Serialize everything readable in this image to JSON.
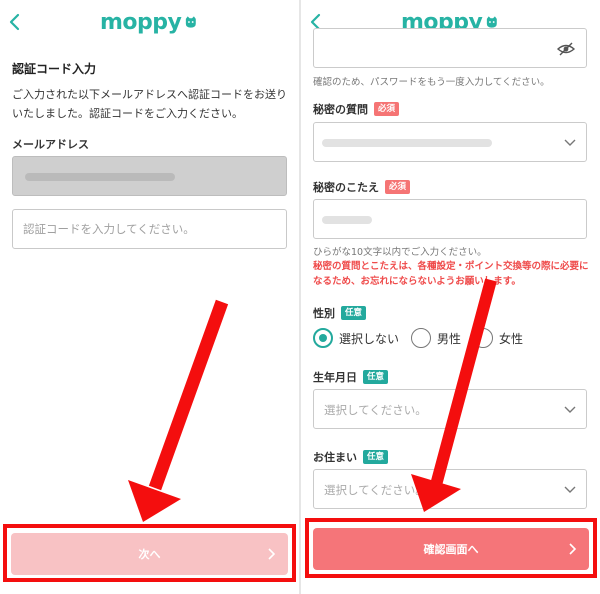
{
  "colors": {
    "brand": "#27b3a4",
    "badge_required": "#f57474",
    "badge_optional": "#23a99d",
    "next_button_disabled": "#f8c2c4",
    "confirm_button": "#f57579",
    "highlight_red": "#f40e0e",
    "warning_text": "#ef4b4b"
  },
  "left": {
    "header": {
      "back_icon": "chevron-left-icon",
      "logo": "moppy"
    },
    "title": "認証コード入力",
    "description": "ご入力された以下メールアドレスへ認証コードをお送りいたしました。認証コードをご入力ください。",
    "email_label": "メールアドレス",
    "code_placeholder": "認証コードを入力してください。",
    "next_button": "次へ"
  },
  "right": {
    "header": {
      "back_icon": "chevron-left-icon",
      "logo": "moppy"
    },
    "password_confirm_hint": "確認のため、パスワードをもう一度入力してください。",
    "secret_question": {
      "label": "秘密の質問",
      "badge": "必須"
    },
    "secret_answer": {
      "label": "秘密のこたえ",
      "badge": "必須",
      "hint": "ひらがな10文字以内でご入力ください。",
      "warning": "秘密の質問とこたえは、各種設定・ポイント交換等の際に必要になるため、お忘れにならないようお願いします。"
    },
    "gender": {
      "label": "性別",
      "badge": "任意",
      "options": [
        "選択しない",
        "男性",
        "女性"
      ],
      "selected": "選択しない"
    },
    "birthday": {
      "label": "生年月日",
      "badge": "任意",
      "placeholder": "選択してください。"
    },
    "residence": {
      "label": "お住まい",
      "badge": "任意",
      "placeholder": "選択してください。"
    },
    "confirm_button": "確認画面へ"
  }
}
